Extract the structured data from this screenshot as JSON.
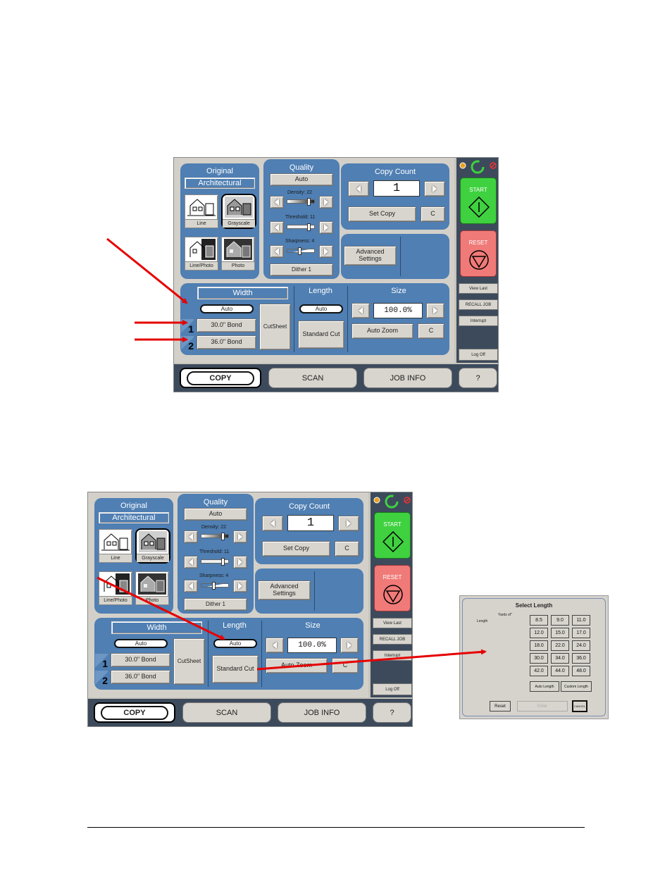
{
  "screen": {
    "original": {
      "title": "Original",
      "value": "Architectural",
      "modes": [
        "Line",
        "Grayscale",
        "Line/Photo",
        "Photo"
      ]
    },
    "quality": {
      "title": "Quality",
      "auto": "Auto",
      "density": "Density: 22",
      "threshold": "Threshold: 11",
      "sharpness": "Sharpness: 4",
      "dither": "Dither 1"
    },
    "copy_count": {
      "title": "Copy Count",
      "value": "1",
      "set_copy": "Set Copy",
      "clear": "C"
    },
    "advanced": "Advanced Settings",
    "width": {
      "title": "Width",
      "auto": "Auto",
      "roll1_num": "1",
      "roll1": "30.0\" Bond",
      "roll2_num": "2",
      "roll2": "36.0\" Bond",
      "cutsheet": "CutSheet"
    },
    "length": {
      "title": "Length",
      "auto": "Auto",
      "standard_cut": "Standard Cut"
    },
    "size": {
      "title": "Size",
      "value": "100.0%",
      "auto_zoom": "Auto Zoom",
      "clear": "C"
    },
    "side": {
      "start": "START",
      "reset": "RESET",
      "view_last": "View Last",
      "recall_job": "RECALL JOB",
      "interrupt": "Interrupt",
      "log_off": "Log Off"
    },
    "tabs": [
      "COPY",
      "SCAN",
      "JOB INFO",
      "?"
    ]
  },
  "dialog": {
    "title": "Select Length",
    "yards_label": "Yards sf\"",
    "length_label": "Length",
    "values": [
      "8.5",
      "9.0",
      "11.0",
      "12.0",
      "15.0",
      "17.0",
      "18.0",
      "22.0",
      "24.0",
      "30.0",
      "34.0",
      "36.0",
      "42.0",
      "44.0",
      "48.0"
    ],
    "auto_length": "Auto Length",
    "custom_length": "Custom Length",
    "reset": "Reset",
    "enter": "Enter",
    "cancel": "CANCEL"
  },
  "colors": {
    "panel": "#4f7fb3",
    "start": "#3fd13f",
    "reset": "#f07a78",
    "arrow": "#e60000"
  }
}
